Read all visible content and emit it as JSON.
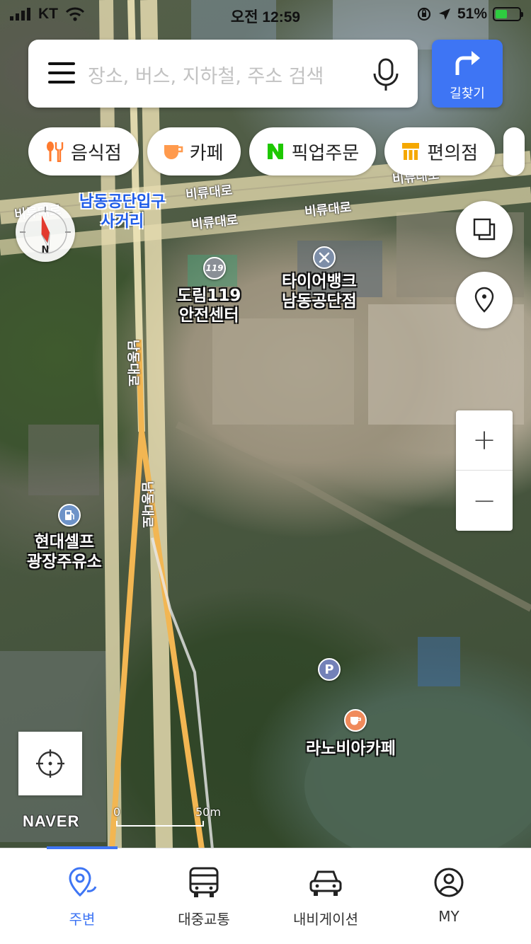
{
  "status_bar": {
    "carrier": "KT",
    "time": "오전 12:59",
    "battery_percent": "51%",
    "battery_level": 0.51
  },
  "search": {
    "placeholder": "장소, 버스, 지하철, 주소 검색"
  },
  "route_button": {
    "label": "길찾기"
  },
  "categories": [
    {
      "label": "음식점",
      "icon": "fork-knife-icon"
    },
    {
      "label": "카페",
      "icon": "coffee-cup-icon"
    },
    {
      "label": "픽업주문",
      "icon": "naver-n-icon"
    },
    {
      "label": "편의점",
      "icon": "store-icon"
    }
  ],
  "map": {
    "road_labels": [
      "비류대로",
      "비류대로",
      "비류대로",
      "비류대로",
      "비류대로",
      "남동대로",
      "남동대로"
    ],
    "intersection_label": [
      "남동공단입구",
      "사거리"
    ],
    "pois": [
      {
        "name_lines": [
          "도림119",
          "안전센터"
        ],
        "icon": "fire-station-icon"
      },
      {
        "name_lines": [
          "타이어뱅크",
          "남동공단점"
        ],
        "icon": "repair-tools-icon"
      },
      {
        "name_lines": [
          "현대셀프",
          "광장주유소"
        ],
        "icon": "gas-station-icon"
      },
      {
        "name_lines": [
          "라노비아카페"
        ],
        "icon": "cafe-icon"
      },
      {
        "name_lines": [],
        "icon": "parking-icon"
      }
    ],
    "compass_label": "N",
    "brand": "NAVER",
    "scale": {
      "start": "0",
      "end": "50m"
    }
  },
  "bottom_nav": [
    {
      "label": "주변",
      "active": true,
      "icon": "location-pin-icon"
    },
    {
      "label": "대중교통",
      "active": false,
      "icon": "bus-icon"
    },
    {
      "label": "내비게이션",
      "active": false,
      "icon": "car-icon"
    },
    {
      "label": "MY",
      "active": false,
      "icon": "user-icon"
    }
  ],
  "colors": {
    "accent": "#3e75f4",
    "chip_food": "#ff7a2e",
    "chip_cafe": "#ff9a4d",
    "chip_pickup": "#1ec800",
    "chip_store": "#f5a800"
  }
}
